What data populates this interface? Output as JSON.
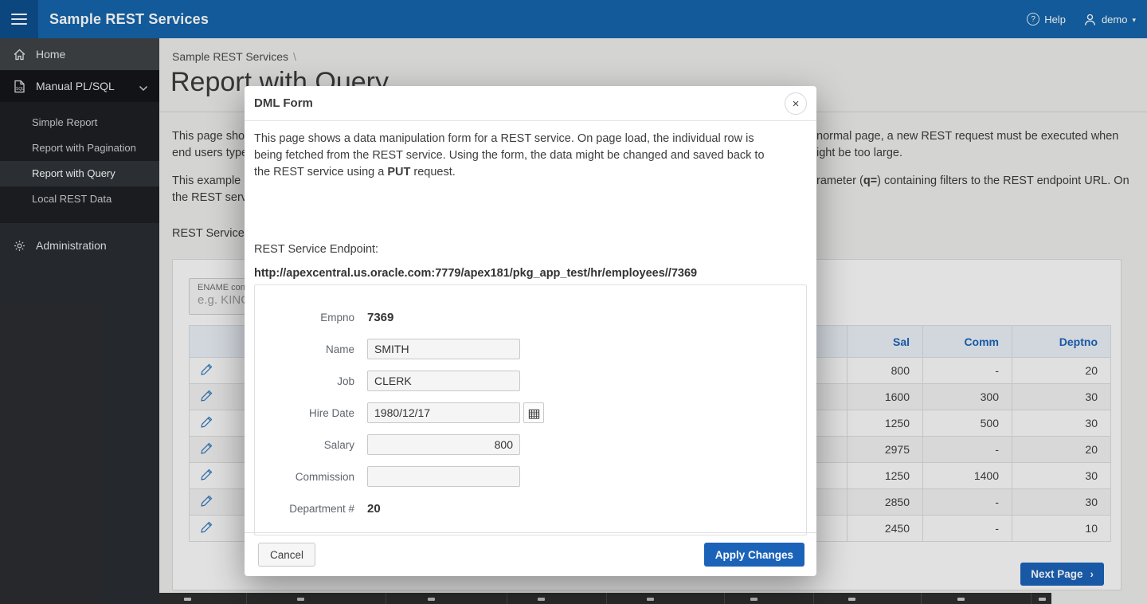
{
  "header": {
    "title": "Sample REST Services",
    "help": "Help",
    "user": "demo",
    "caret": "▾"
  },
  "sidebar": {
    "home": "Home",
    "manual": "Manual PL/SQL",
    "subitems": [
      {
        "label": "Simple Report"
      },
      {
        "label": "Report with Pagination"
      },
      {
        "label": "Report with Query"
      },
      {
        "label": "Local REST Data"
      }
    ],
    "admin": "Administration"
  },
  "breadcrumb": {
    "app": "Sample REST Services",
    "sep": "\\"
  },
  "page": {
    "title": "Report with Query",
    "p1_left1": "This page show",
    "p1_right1": "normal page, a new REST request must be executed when",
    "p1_left2": "end users type",
    "p1_right2": "ight be too large.",
    "p2_left1": "This example u",
    "p2_right1a": "rameter (",
    "p2_right1b": "q=",
    "p2_right1c": ") containing filters to the REST endpoint URL. On",
    "p2_left2": "the REST serv",
    "endpoint_label": "REST Service Endpoint:"
  },
  "filter": {
    "label": "ENAME contains",
    "placeholder": "e.g. KING"
  },
  "report_table": {
    "headers": {
      "sal": "Sal",
      "comm": "Comm",
      "deptno": "Deptno"
    },
    "rows": [
      {
        "sal": "800",
        "comm": "-",
        "deptno": "20"
      },
      {
        "sal": "1600",
        "comm": "300",
        "deptno": "30"
      },
      {
        "sal": "1250",
        "comm": "500",
        "deptno": "30"
      },
      {
        "sal": "2975",
        "comm": "-",
        "deptno": "20"
      },
      {
        "sal": "1250",
        "comm": "1400",
        "deptno": "30"
      },
      {
        "sal": "2850",
        "comm": "-",
        "deptno": "30"
      },
      {
        "sal": "2450",
        "comm": "-",
        "deptno": "10"
      }
    ]
  },
  "pagination": {
    "next": "Next Page",
    "chevron": "›"
  },
  "modal": {
    "title": "DML Form",
    "body_a": "This page shows a data manipulation form for a REST service. On page load, the individual row is being fetched from the REST service. Using the form, the data might be changed and saved back to the REST service using a ",
    "body_b": "PUT",
    "body_c": " request.",
    "endpoint_label": "REST Service Endpoint:",
    "endpoint_url": "http://apexcentral.us.oracle.com:7779/apex181/pkg_app_test/hr/employees//7369",
    "form": {
      "empno_label": "Empno",
      "empno_value": "7369",
      "name_label": "Name",
      "name_value": "SMITH",
      "job_label": "Job",
      "job_value": "CLERK",
      "hire_label": "Hire Date",
      "hire_value": "1980/12/17",
      "salary_label": "Salary",
      "salary_value": "800",
      "comm_label": "Commission",
      "comm_value": "",
      "dept_label": "Department #",
      "dept_value": "20"
    },
    "cancel": "Cancel",
    "apply": "Apply Changes",
    "close": "×"
  },
  "colors": {
    "header_blue": "#1565ab",
    "accent_blue": "#1b63b8",
    "link_blue": "#1c63b8"
  }
}
